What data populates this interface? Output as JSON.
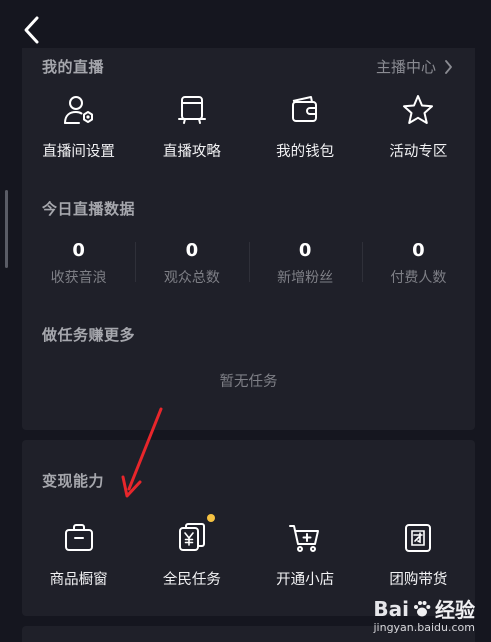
{
  "nav": {
    "back_icon": "chevron-left-icon"
  },
  "my_live": {
    "title": "我的直播",
    "anchor_center": "主播中心",
    "items": [
      {
        "label": "直播间设置",
        "icon": "user-gear-icon"
      },
      {
        "label": "直播攻略",
        "icon": "tv-guide-icon"
      },
      {
        "label": "我的钱包",
        "icon": "wallet-icon"
      },
      {
        "label": "活动专区",
        "icon": "star-icon"
      }
    ]
  },
  "today_data": {
    "title": "今日直播数据",
    "stats": [
      {
        "value": "0",
        "label": "收获音浪"
      },
      {
        "value": "0",
        "label": "观众总数"
      },
      {
        "value": "0",
        "label": "新增粉丝"
      },
      {
        "value": "0",
        "label": "付费人数"
      }
    ]
  },
  "tasks": {
    "title": "做任务赚更多",
    "empty_text": "暂无任务"
  },
  "monetize": {
    "title": "变现能力",
    "items": [
      {
        "label": "商品橱窗",
        "icon": "briefcase-icon"
      },
      {
        "label": "全民任务",
        "icon": "yuan-card-icon",
        "badge_color": "#f5c242"
      },
      {
        "label": "开通小店",
        "icon": "cart-plus-icon"
      },
      {
        "label": "团购带货",
        "icon": "group-buy-icon"
      }
    ]
  },
  "watermark": {
    "logo_text_a": "Bai",
    "logo_text_b": "经验",
    "sub": "jingyan.baidu.com"
  },
  "colors": {
    "background": "#15161f",
    "card": "#1f2029",
    "accent_dot": "#f5c242",
    "arrow": "#e8262b"
  }
}
